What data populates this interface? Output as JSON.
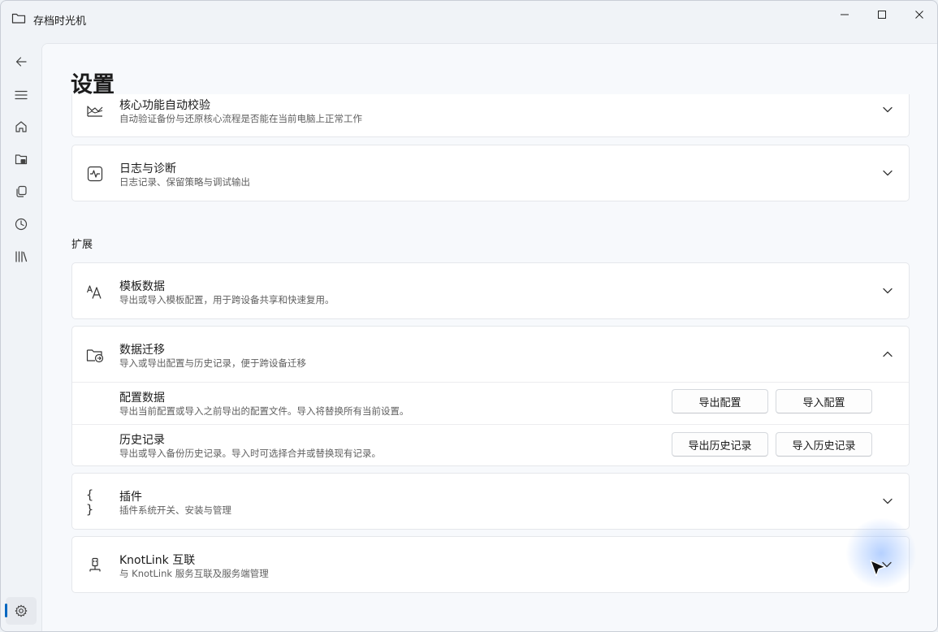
{
  "window": {
    "title": "存档时光机"
  },
  "page": {
    "title": "设置"
  },
  "section": {
    "extensions": "扩展"
  },
  "cards": {
    "self_check": {
      "title": "核心功能自动校验",
      "subtitle": "自动验证备份与还原核心流程是否能在当前电脑上正常工作"
    },
    "logs": {
      "title": "日志与诊断",
      "subtitle": "日志记录、保留策略与调试输出"
    },
    "templates": {
      "title": "模板数据",
      "subtitle": "导出或导入模板配置，用于跨设备共享和快速复用。"
    },
    "migration": {
      "title": "数据迁移",
      "subtitle": "导入或导出配置与历史记录，便于跨设备迁移",
      "config": {
        "title": "配置数据",
        "subtitle": "导出当前配置或导入之前导出的配置文件。导入将替换所有当前设置。",
        "export_label": "导出配置",
        "import_label": "导入配置"
      },
      "history": {
        "title": "历史记录",
        "subtitle": "导出或导入备份历史记录。导入时可选择合并或替换现有记录。",
        "export_label": "导出历史记录",
        "import_label": "导入历史记录"
      }
    },
    "plugins": {
      "title": "插件",
      "subtitle": "插件系统开关、安装与管理",
      "icon_text": "{ }"
    },
    "knotlink": {
      "title": "KnotLink 互联",
      "subtitle": "与 KnotLink 服务互联及服务端管理"
    }
  },
  "icons": {
    "nav": [
      "back-arrow-icon",
      "menu-icon",
      "home-icon",
      "backup-drive-icon",
      "copy-icon",
      "clock-icon",
      "library-icon",
      "gear-icon"
    ],
    "accent": "#0067c0"
  }
}
